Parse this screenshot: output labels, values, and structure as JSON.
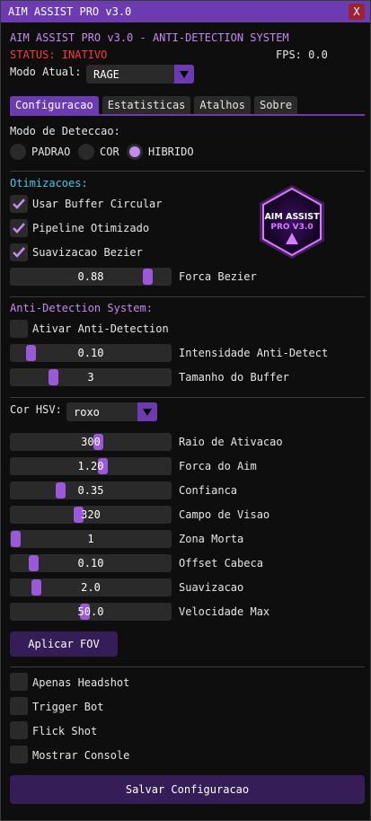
{
  "window": {
    "title": "AIM ASSIST PRO v3.0",
    "close_label": "X"
  },
  "header": {
    "title": "AIM ASSIST PRO v3.0 - ANTI-DETECTION SYSTEM",
    "status": "STATUS: INATIVO",
    "fps": "FPS: 0.0"
  },
  "mode": {
    "label": "Modo Atual:",
    "value": "RAGE"
  },
  "tabs": [
    {
      "label": "Configuracao",
      "active": true
    },
    {
      "label": "Estatisticas",
      "active": false
    },
    {
      "label": "Atalhos",
      "active": false
    },
    {
      "label": "Sobre",
      "active": false
    }
  ],
  "detection": {
    "label": "Modo de Deteccao:",
    "options": [
      {
        "label": "PADRAO",
        "selected": false
      },
      {
        "label": "COR",
        "selected": false
      },
      {
        "label": "HIBRIDO",
        "selected": true
      }
    ]
  },
  "optimizations": {
    "title": "Otimizacoes:",
    "checks": [
      {
        "label": "Usar Buffer Circular",
        "checked": true
      },
      {
        "label": "Pipeline Otimizado",
        "checked": true
      },
      {
        "label": "Suavizacao Bezier",
        "checked": true
      }
    ],
    "bezier": {
      "value": "0.88",
      "label": "Forca Bezier",
      "fraction": 0.88
    }
  },
  "logo": {
    "line1": "AIM ASSIST",
    "line2": "PRO V3.0"
  },
  "anti_detection": {
    "title": "Anti-Detection System:",
    "enable_label": "Ativar Anti-Detection",
    "enabled": false,
    "intensity": {
      "value": "0.10",
      "label": "Intensidade Anti-Detect",
      "fraction": 0.1
    },
    "buffer": {
      "value": "3",
      "label": "Tamanho do Buffer",
      "fraction": 0.25
    }
  },
  "hsv": {
    "label": "Cor HSV:",
    "value": "roxo"
  },
  "sliders": [
    {
      "value": "300",
      "label": "Raio de Ativacao",
      "fraction": 0.55
    },
    {
      "value": "1.20",
      "label": "Forca do Aim",
      "fraction": 0.58
    },
    {
      "value": "0.35",
      "label": "Confianca",
      "fraction": 0.3
    },
    {
      "value": "320",
      "label": "Campo de Visao",
      "fraction": 0.42
    },
    {
      "value": "1",
      "label": "Zona Morta",
      "fraction": 0.0
    },
    {
      "value": "0.10",
      "label": "Offset Cabeca",
      "fraction": 0.12
    },
    {
      "value": "2.0",
      "label": "Suavizacao",
      "fraction": 0.14
    },
    {
      "value": "50.0",
      "label": "Velocidade Max",
      "fraction": 0.46
    }
  ],
  "apply_fov_label": "Aplicar FOV",
  "extras": [
    {
      "label": "Apenas Headshot",
      "checked": false
    },
    {
      "label": "Trigger Bot",
      "checked": false
    },
    {
      "label": "Flick Shot",
      "checked": false
    },
    {
      "label": "Mostrar Console",
      "checked": false
    }
  ],
  "save_label": "Salvar Configuracao",
  "colors": {
    "accent": "#6c3bb0",
    "slider_grab": "#9b59d9",
    "header": "#c58af0",
    "section": "#47c7e8",
    "status": "#ff3a3a"
  }
}
